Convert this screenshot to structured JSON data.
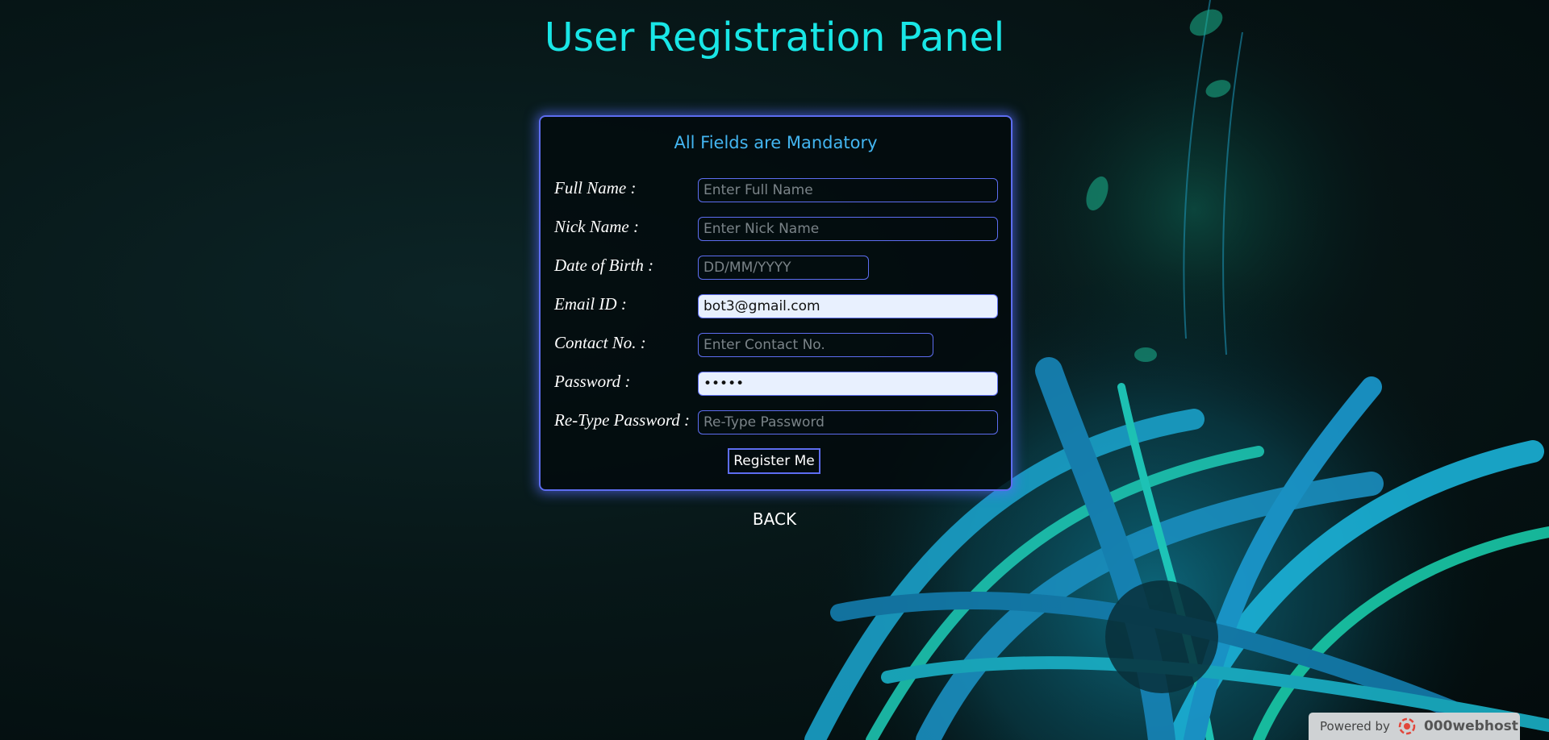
{
  "page": {
    "title": "User Registration Panel"
  },
  "form": {
    "notice": "All Fields are Mandatory",
    "fields": [
      {
        "label": "Full Name :",
        "placeholder": "Enter Full Name",
        "value": ""
      },
      {
        "label": "Nick Name :",
        "placeholder": "Enter Nick Name",
        "value": ""
      },
      {
        "label": "Date of Birth :",
        "placeholder": "DD/MM/YYYY",
        "value": ""
      },
      {
        "label": "Email ID :",
        "placeholder": "",
        "value": "bot3@gmail.com"
      },
      {
        "label": "Contact No. :",
        "placeholder": "Enter Contact No.",
        "value": ""
      },
      {
        "label": "Password :",
        "placeholder": "",
        "value": "•••••"
      },
      {
        "label": "Re-Type Password :",
        "placeholder": "Re-Type Password",
        "value": ""
      }
    ],
    "submit_label": "Register Me"
  },
  "back_label": "BACK",
  "footer": {
    "powered_by": "Powered by",
    "brand": "000webhost"
  },
  "colors": {
    "title": "#19e6e6",
    "notice": "#43b5f0",
    "border": "#5d6df0",
    "autofill": "#e8f0fe"
  }
}
